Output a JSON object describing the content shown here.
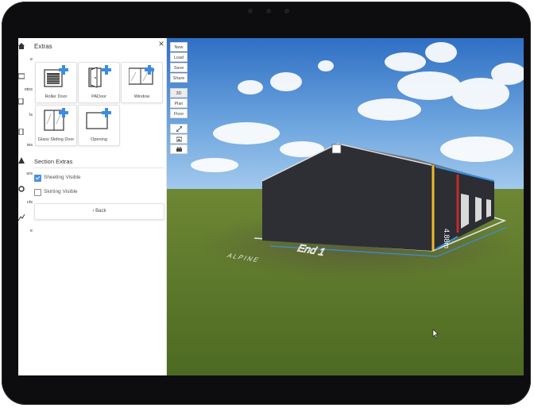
{
  "app": {
    "left_nav": [
      {
        "icon": "home-icon",
        "label": "e"
      },
      {
        "icon": "photos-icon",
        "label": "otos"
      },
      {
        "icon": "walls-icon",
        "label": "ls"
      },
      {
        "icon": "doors-icon",
        "label": "ies"
      },
      {
        "icon": "colours-icon",
        "label": "urs"
      },
      {
        "icon": "products-icon",
        "label": "cts"
      },
      {
        "icon": "quote-icon",
        "label": "e"
      }
    ]
  },
  "panel": {
    "title": "Extras",
    "close_label": "×",
    "tiles": [
      {
        "label": "Roller Door",
        "icon": "roller-door-icon"
      },
      {
        "label": "PADoor",
        "icon": "pa-door-icon"
      },
      {
        "label": "Window",
        "icon": "window-icon"
      },
      {
        "label": "Glass Sliding Door",
        "icon": "glass-sliding-door-icon"
      },
      {
        "label": "Opening",
        "icon": "opening-icon"
      }
    ],
    "section_title": "Section Extras",
    "checks": [
      {
        "label": "Sheeting Visible",
        "checked": true
      },
      {
        "label": "Skirting Visible",
        "checked": false
      }
    ],
    "back_label": "‹  Back"
  },
  "toolbar": {
    "file_buttons": [
      "New",
      "Load",
      "Save",
      "Share"
    ],
    "view_buttons": [
      "3D",
      "Plan",
      "Floor"
    ],
    "active_view": "3D",
    "tool_icons": [
      "expand-icon",
      "image-icon",
      "print-icon"
    ]
  },
  "scene": {
    "dimension_label": "4.88m",
    "end_label": "End 1",
    "ground_text": "ALPINE",
    "colors": {
      "sky_top": "#2f6fc4",
      "sky_bottom": "#a9cdee",
      "grass": "#5f7a2c",
      "building": "#2c2e33",
      "accent_yellow": "#f0b92a",
      "accent_red": "#c62a2a",
      "accent_blue": "#3a8de0"
    }
  }
}
